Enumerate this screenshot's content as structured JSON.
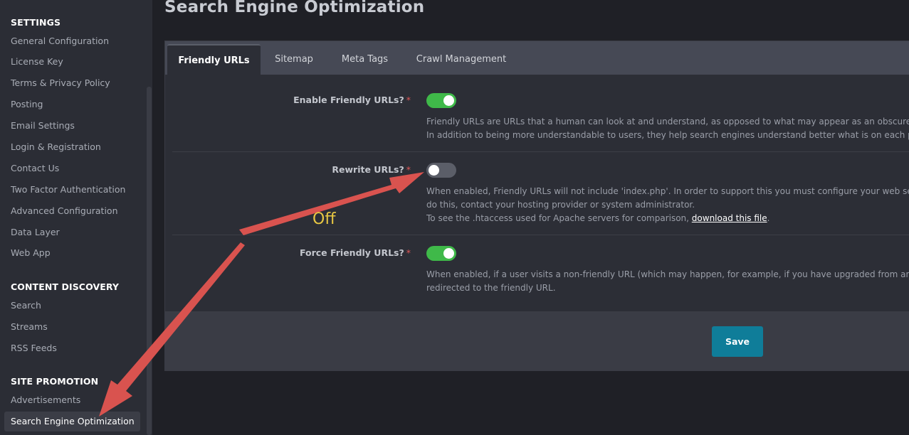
{
  "sidebar": {
    "sections": [
      {
        "heading": "SETTINGS",
        "items": [
          "General Configuration",
          "License Key",
          "Terms & Privacy Policy",
          "Posting",
          "Email Settings",
          "Login & Registration",
          "Contact Us",
          "Two Factor Authentication",
          "Advanced Configuration",
          "Data Layer",
          "Web App"
        ]
      },
      {
        "heading": "CONTENT DISCOVERY",
        "items": [
          "Search",
          "Streams",
          "RSS Feeds"
        ]
      },
      {
        "heading": "SITE PROMOTION",
        "items": [
          "Advertisements",
          "Search Engine Optimization"
        ]
      }
    ]
  },
  "page": {
    "title": "Search Engine Optimization"
  },
  "tabs": [
    {
      "label": "Friendly URLs",
      "active": true
    },
    {
      "label": "Sitemap",
      "active": false
    },
    {
      "label": "Meta Tags",
      "active": false
    },
    {
      "label": "Crawl Management",
      "active": false
    }
  ],
  "settings": [
    {
      "label": "Enable Friendly URLs?",
      "required": "*",
      "enabled": true,
      "desc": [
        "Friendly URLs are URLs that a human can look at and understand, as opposed to what may appear as an obscure string",
        "In addition to being more understandable to users, they help search engines understand better what is on each page."
      ]
    },
    {
      "label": "Rewrite URLs?",
      "required": "*",
      "enabled": false,
      "desc": [
        "When enabled, Friendly URLs will not include 'index.php'. In order to support this you must configure your web server t",
        "do this, contact your hosting provider or system administrator.",
        "To see the .htaccess used for Apache servers for comparison, "
      ],
      "link": "download this file",
      "link_suffix": "."
    },
    {
      "label": "Force Friendly URLs?",
      "required": "*",
      "enabled": true,
      "desc": [
        "When enabled, if a user visits a non-friendly URL (which may happen, for example, if you have upgraded from an older",
        "redirected to the friendly URL."
      ]
    }
  ],
  "footer": {
    "save_label": "Save"
  },
  "annotation": {
    "text": "Off",
    "arrow_color": "#d9534f",
    "text_color": "#e8c743"
  },
  "colors": {
    "toggle_on": "#3fb949",
    "toggle_off": "#5b5e68",
    "save_button": "#0f7d99",
    "required": "#e05656"
  }
}
